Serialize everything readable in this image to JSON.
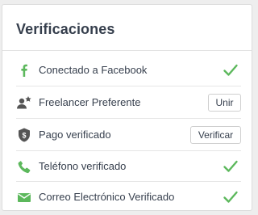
{
  "card": {
    "title": "Verificaciones"
  },
  "items": [
    {
      "icon": "facebook-icon",
      "label": "Conectado a Facebook",
      "status": "verified"
    },
    {
      "icon": "preferred-freelancer-icon",
      "label": "Freelancer Preferente",
      "action_label": "Unir"
    },
    {
      "icon": "payment-shield-icon",
      "label": "Pago verificado",
      "action_label": "Verificar"
    },
    {
      "icon": "phone-icon",
      "label": "Teléfono verificado",
      "status": "verified"
    },
    {
      "icon": "email-icon",
      "label": "Correo Electrónico Verificado",
      "status": "verified"
    }
  ],
  "colors": {
    "verified_green": "#5cb85c",
    "icon_gray": "#555555",
    "text_dark": "#363f4d"
  }
}
